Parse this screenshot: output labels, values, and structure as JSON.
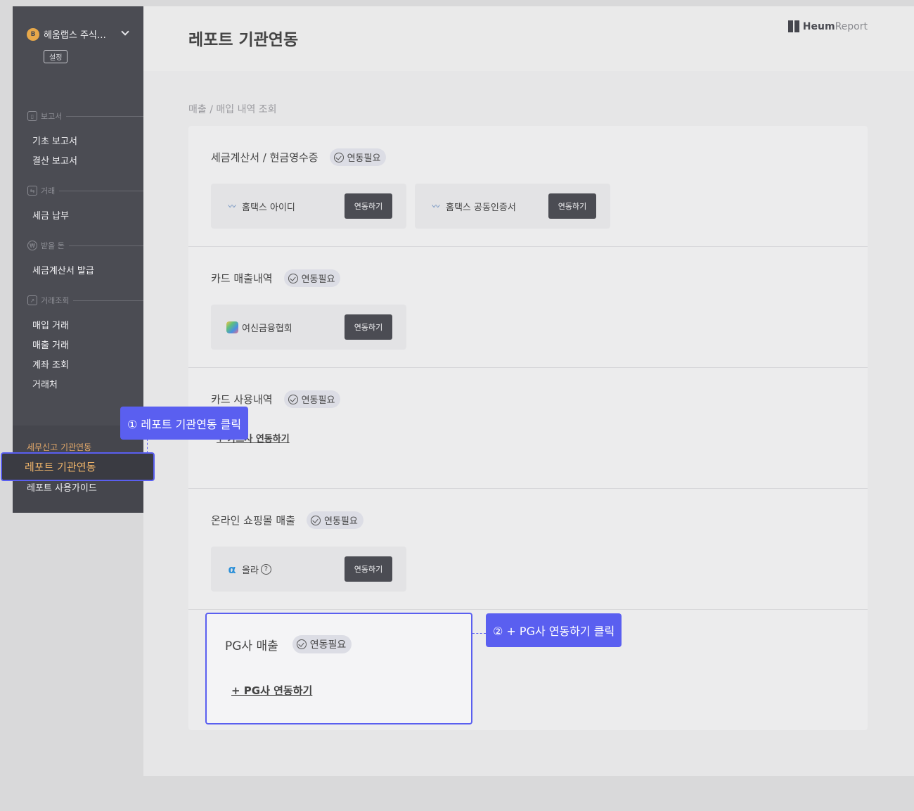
{
  "sidebar": {
    "company": {
      "logo": "B",
      "name": "헤움랩스 주식…"
    },
    "settings_label": "설정",
    "sections": [
      {
        "icon": "bar-chart-icon",
        "glyph": "▯",
        "title": "보고서",
        "items": [
          "기초 보고서",
          "결산 보고서"
        ]
      },
      {
        "icon": "exchange-icon",
        "glyph": "⇆",
        "title": "거래",
        "items": [
          "세금 납부"
        ]
      },
      {
        "icon": "won-coin-icon",
        "glyph": "₩",
        "title": "받을 돈",
        "items": [
          "세금계산서 발급"
        ]
      },
      {
        "icon": "trend-chart-icon",
        "glyph": "↗",
        "title": "거래조회",
        "items": [
          "매입 거래",
          "매출 거래",
          "계좌 조회",
          "거래처"
        ]
      }
    ],
    "bottom": {
      "link1": "세무신고 기관연동",
      "active": "레포트 기관연동",
      "link3": "레포트 사용가이드"
    }
  },
  "header": {
    "title": "레포트 기관연동",
    "brand": {
      "part1": "Heum",
      "part2": "Report"
    }
  },
  "subtitle": "매출 / 매입 내역 조회",
  "badge_label": "연동필요",
  "link_button_label": "연동하기",
  "blocks": [
    {
      "title": "세금계산서 / 현금영수증",
      "orgs": [
        {
          "icon": "hometax-icon",
          "name": "홈택스 아이디"
        },
        {
          "icon": "hometax-icon",
          "name": "홈택스 공동인증서"
        }
      ]
    },
    {
      "title": "카드 매출내역",
      "orgs": [
        {
          "icon": "credit-association-icon",
          "name": "여신금융협회"
        }
      ]
    },
    {
      "title": "카드 사용내역",
      "add_link": "+ 카드사 연동하기"
    },
    {
      "title": "온라인 쇼핑몰 매출",
      "orgs": [
        {
          "icon": "olla-icon",
          "name": "올라"
        }
      ]
    }
  ],
  "pg": {
    "title": "PG사 매출",
    "add_link": "+ PG사 연동하기"
  },
  "callouts": {
    "step1": "① 레포트 기관연동 클릭",
    "step2": "② + PG사 연동하기 클릭"
  },
  "colors": {
    "accent": "#5a5ff0",
    "sidebar": "#4b4c53",
    "active_text": "#f0b56a"
  }
}
